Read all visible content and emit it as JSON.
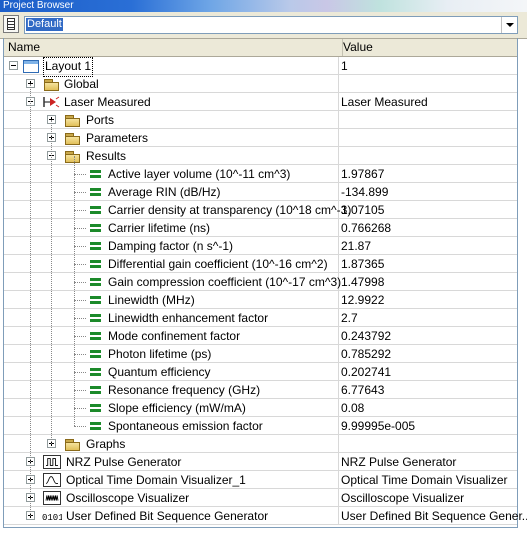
{
  "window": {
    "title": "Project Browser"
  },
  "toolbar": {
    "dropdown_value": "Default"
  },
  "columns": {
    "name": "Name",
    "value": "Value"
  },
  "tree": {
    "layout": {
      "label": "Layout 1",
      "value": "1"
    },
    "global": {
      "label": "Global"
    },
    "laser": {
      "label": "Laser Measured",
      "value": "Laser Measured"
    },
    "ports": {
      "label": "Ports"
    },
    "parameters": {
      "label": "Parameters"
    },
    "results": {
      "label": "Results",
      "items": [
        {
          "label": "Active layer volume (10^-11 cm^3)",
          "value": "1.97867"
        },
        {
          "label": "Average RIN (dB/Hz)",
          "value": "-134.899"
        },
        {
          "label": "Carrier density at transparency (10^18 cm^-3)",
          "value": "1.07105"
        },
        {
          "label": "Carrier lifetime (ns)",
          "value": "0.766268"
        },
        {
          "label": "Damping factor (n s^-1)",
          "value": "21.87"
        },
        {
          "label": "Differential gain coefficient (10^-16 cm^2)",
          "value": "1.87365"
        },
        {
          "label": "Gain compression coefficient (10^-17 cm^3)",
          "value": "1.47998"
        },
        {
          "label": "Linewidth (MHz)",
          "value": "12.9922"
        },
        {
          "label": "Linewidth enhancement factor",
          "value": "2.7"
        },
        {
          "label": "Mode confinement factor",
          "value": "0.243792"
        },
        {
          "label": "Photon lifetime (ps)",
          "value": "0.785292"
        },
        {
          "label": "Quantum efficiency",
          "value": "0.202741"
        },
        {
          "label": "Resonance frequency (GHz)",
          "value": "6.77643"
        },
        {
          "label": "Slope efficiency (mW/mA)",
          "value": "0.08"
        },
        {
          "label": "Spontaneous emission factor",
          "value": "9.99995e-005"
        }
      ]
    },
    "graphs": {
      "label": "Graphs"
    },
    "components": [
      {
        "label": "NRZ Pulse Generator",
        "value": "NRZ Pulse Generator",
        "icon": "pulse-generator-icon"
      },
      {
        "label": "Optical Time Domain Visualizer_1",
        "value": "Optical Time Domain Visualizer",
        "icon": "optical-visualizer-icon"
      },
      {
        "label": "Oscilloscope Visualizer",
        "value": "Oscilloscope Visualizer",
        "icon": "oscilloscope-icon"
      },
      {
        "label": "User Defined Bit Sequence Generator",
        "value": "User Defined Bit Sequence Gener...",
        "icon": "bit-sequence-icon"
      }
    ]
  }
}
